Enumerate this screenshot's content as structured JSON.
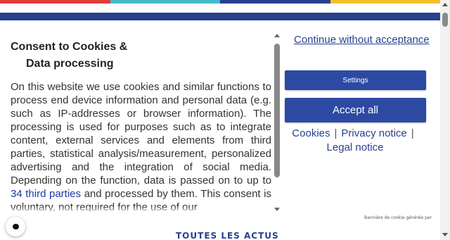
{
  "colors": {
    "stripe": [
      "#e03c3c",
      "#46b8c8",
      "#27418f",
      "#f2c12e"
    ],
    "brand": "#27418f",
    "button": "#2d4aa3"
  },
  "page": {
    "bottom_link": "TOUTES LES ACTUS"
  },
  "consent": {
    "title_line1": "Consent to Cookies &",
    "title_line2": "Data processing",
    "body_before_link": "On this website we use cookies and similar functions to process end device information and personal data (e.g. such as IP-addresses or browser information). The processing is used for purposes such as to integrate content, external services and elements from third parties, statistical analysis/measurement, personalized advertising and the integration of social media. Depending on the function, data is passed on to up to ",
    "third_parties_link": "34 third parties",
    "body_after_link": " and processed by them. This consent is voluntary, not required for the use of our",
    "continue_label": "Continue without acceptance",
    "settings_label": "Settings",
    "accept_label": "Accept all",
    "cookies_link": "Cookies",
    "privacy_link": "Privacy notice",
    "legal_link": "Legal notice",
    "separator": "|",
    "generated_by": "Bannière de cookie générée par"
  }
}
